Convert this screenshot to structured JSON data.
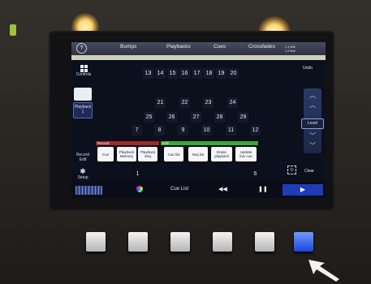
{
  "topbar": {
    "help": "?",
    "tabs": [
      "Bumps",
      "Playbacks",
      "Cues",
      "Crossfades"
    ],
    "info": [
      "1.1 line",
      "1.2 line"
    ]
  },
  "sidebar": {
    "controls_label": "Controls",
    "playback_label": "Playback",
    "playback_number": "1",
    "record_edit_label": "Record\nEdit",
    "setup_label": "Setup"
  },
  "grid": {
    "row1": [
      "13",
      "14",
      "15",
      "16",
      "17",
      "18",
      "19",
      "20"
    ],
    "row2": [
      "21",
      "22",
      "23",
      "24"
    ],
    "row3": [
      "25",
      "26",
      "27",
      "28",
      "29"
    ],
    "row4": [
      "7",
      "8",
      "9",
      "10",
      "11",
      "12"
    ],
    "row5_left": "1",
    "row5_right": "6"
  },
  "action_panel": {
    "record_header": "Record",
    "edit_header": "Edit",
    "record_buttons": [
      "Cue",
      "Playback\nMemory",
      "Playback\nSeq"
    ],
    "edit_buttons": [
      "Cue list",
      "Seq list",
      "Erase\nplayback",
      "Update\nlive cue"
    ]
  },
  "right": {
    "undo": "Undo",
    "level": "Level",
    "clear": "Clear"
  },
  "bottombar": {
    "cue_list": "Cue List",
    "rewind": "◀◀",
    "pause": "❚❚",
    "play": "▶"
  },
  "colors": {
    "accent_blue": "#1d3cb6",
    "record_red": "#a12828",
    "edit_green": "#3aa83a"
  }
}
